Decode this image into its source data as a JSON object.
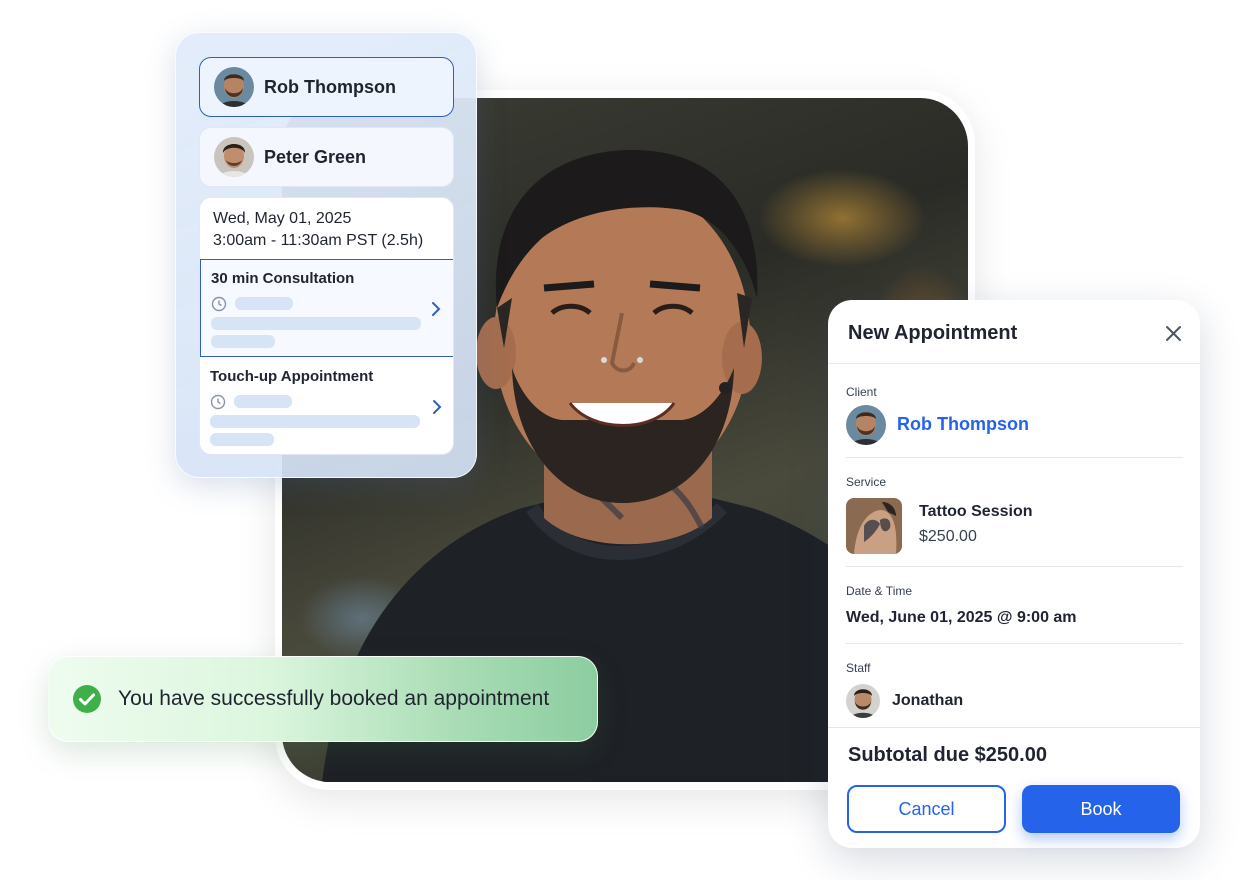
{
  "staff_picker": {
    "people": [
      {
        "name": "Rob Thompson",
        "selected": true
      },
      {
        "name": "Peter Green",
        "selected": false
      }
    ],
    "slot": {
      "date": "Wed, May 01, 2025",
      "time": "3:00am - 11:30am PST (2.5h)"
    },
    "services": [
      {
        "title": "30 min Consultation",
        "selected": true
      },
      {
        "title": "Touch-up Appointment",
        "selected": false
      }
    ]
  },
  "toast": {
    "message": "You have successfully booked an appointment",
    "icon": "check-circle-icon",
    "color": "#3fb049"
  },
  "appointment": {
    "title": "New Appointment",
    "client_label": "Client",
    "client_name": "Rob Thompson",
    "service_label": "Service",
    "service_name": "Tattoo Session",
    "service_price": "$250.00",
    "datetime_label": "Date & Time",
    "datetime_value": "Wed, June 01, 2025 @ 9:00 am",
    "staff_label": "Staff",
    "staff_name": "Jonathan",
    "subtotal": "Subtotal due $250.00",
    "cancel_label": "Cancel",
    "book_label": "Book"
  },
  "colors": {
    "accent": "#2563eb",
    "selected_border": "#2f5fb8",
    "success": "#3fb049"
  }
}
